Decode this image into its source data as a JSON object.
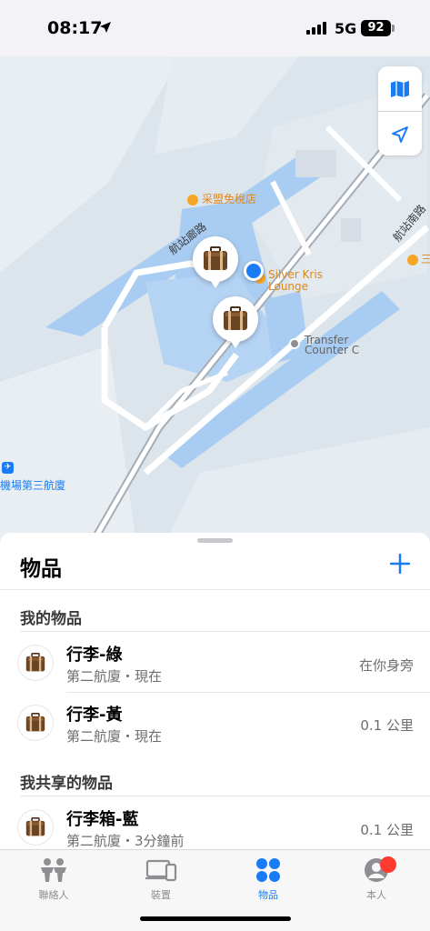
{
  "status_bar": {
    "time": "08:17",
    "network": "5G",
    "battery": "92"
  },
  "map": {
    "labels": {
      "duty_free": "采盟免稅店",
      "road_left": "航站廊路",
      "road_right": "航站南路",
      "lounge_line1": "Silver Kris",
      "lounge_line2": "Lounge",
      "transfer_line1": "Transfer",
      "transfer_line2": "Counter C",
      "terminal": "機場第三航廈",
      "right_edge": "三"
    },
    "colors": {
      "poi_orange": "#f5a623",
      "user_blue": "#1a7cf5",
      "terminal_blue": "#a9cdf2"
    }
  },
  "sheet": {
    "title": "物品",
    "my_items_header": "我的物品",
    "shared_items_header": "我共享的物品",
    "my_items": [
      {
        "name": "行李-綠",
        "subtitle": "第二航廈・現在",
        "distance": "在你身旁"
      },
      {
        "name": "行李-黃",
        "subtitle": "第二航廈・現在",
        "distance": "0.1 公里"
      }
    ],
    "shared_items": [
      {
        "name": "行李箱-藍",
        "subtitle": "第二航廈・3分鐘前",
        "distance": "0.1 公里"
      }
    ]
  },
  "tabs": [
    {
      "label": "聯絡人",
      "icon": "people-icon"
    },
    {
      "label": "裝置",
      "icon": "devices-icon"
    },
    {
      "label": "物品",
      "icon": "items-icon"
    },
    {
      "label": "本人",
      "icon": "me-icon"
    }
  ]
}
